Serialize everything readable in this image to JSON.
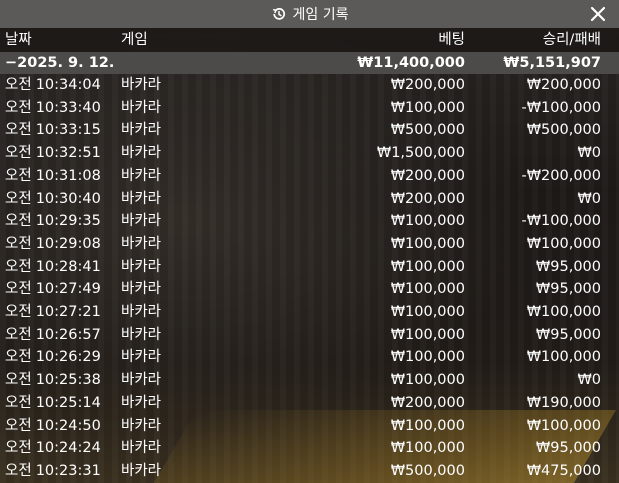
{
  "title": "게임 기록",
  "icons": {
    "history": "history-icon",
    "close": "close-icon"
  },
  "columns": {
    "date": "날짜",
    "game": "게임",
    "bet": "베팅",
    "result": "승리/패배"
  },
  "summary": {
    "date": "−2025. 9. 12.",
    "bet": "₩11,400,000",
    "result": "₩5,151,907"
  },
  "rows": [
    {
      "ampm": "오전",
      "time": "10:34:04",
      "game": "바카라",
      "bet": "₩200,000",
      "result": "₩200,000"
    },
    {
      "ampm": "오전",
      "time": "10:33:40",
      "game": "바카라",
      "bet": "₩100,000",
      "result": "-₩100,000"
    },
    {
      "ampm": "오전",
      "time": "10:33:15",
      "game": "바카라",
      "bet": "₩500,000",
      "result": "₩500,000"
    },
    {
      "ampm": "오전",
      "time": "10:32:51",
      "game": "바카라",
      "bet": "₩1,500,000",
      "result": "₩0"
    },
    {
      "ampm": "오전",
      "time": "10:31:08",
      "game": "바카라",
      "bet": "₩200,000",
      "result": "-₩200,000"
    },
    {
      "ampm": "오전",
      "time": "10:30:40",
      "game": "바카라",
      "bet": "₩200,000",
      "result": "₩0"
    },
    {
      "ampm": "오전",
      "time": "10:29:35",
      "game": "바카라",
      "bet": "₩100,000",
      "result": "-₩100,000"
    },
    {
      "ampm": "오전",
      "time": "10:29:08",
      "game": "바카라",
      "bet": "₩100,000",
      "result": "₩100,000"
    },
    {
      "ampm": "오전",
      "time": "10:28:41",
      "game": "바카라",
      "bet": "₩100,000",
      "result": "₩95,000"
    },
    {
      "ampm": "오전",
      "time": "10:27:49",
      "game": "바카라",
      "bet": "₩100,000",
      "result": "₩95,000"
    },
    {
      "ampm": "오전",
      "time": "10:27:21",
      "game": "바카라",
      "bet": "₩100,000",
      "result": "₩100,000"
    },
    {
      "ampm": "오전",
      "time": "10:26:57",
      "game": "바카라",
      "bet": "₩100,000",
      "result": "₩95,000"
    },
    {
      "ampm": "오전",
      "time": "10:26:29",
      "game": "바카라",
      "bet": "₩100,000",
      "result": "₩100,000"
    },
    {
      "ampm": "오전",
      "time": "10:25:38",
      "game": "바카라",
      "bet": "₩100,000",
      "result": "₩0"
    },
    {
      "ampm": "오전",
      "time": "10:25:14",
      "game": "바카라",
      "bet": "₩200,000",
      "result": "₩190,000"
    },
    {
      "ampm": "오전",
      "time": "10:24:50",
      "game": "바카라",
      "bet": "₩100,000",
      "result": "₩100,000"
    },
    {
      "ampm": "오전",
      "time": "10:24:24",
      "game": "바카라",
      "bet": "₩100,000",
      "result": "₩95,000"
    },
    {
      "ampm": "오전",
      "time": "10:23:31",
      "game": "바카라",
      "bet": "₩500,000",
      "result": "₩475,000"
    }
  ]
}
